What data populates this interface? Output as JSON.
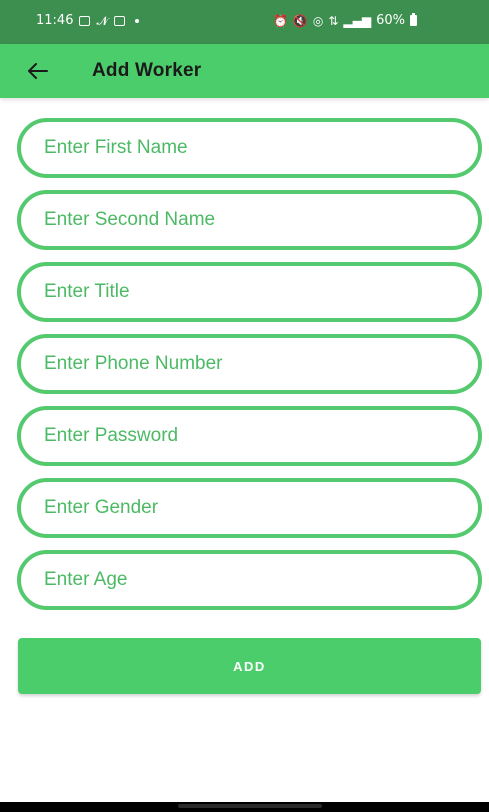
{
  "status_bar": {
    "time": "11:46",
    "network": "⇅",
    "battery_level": "60%"
  },
  "app_bar": {
    "title": "Add Worker",
    "back_icon": "arrow-left-icon"
  },
  "form": {
    "fields": [
      {
        "placeholder": "Enter First Name",
        "value": ""
      },
      {
        "placeholder": "Enter Second Name",
        "value": ""
      },
      {
        "placeholder": "Enter Title",
        "value": ""
      },
      {
        "placeholder": "Enter Phone Number",
        "value": ""
      },
      {
        "placeholder": "Enter Password",
        "value": ""
      },
      {
        "placeholder": "Enter Gender",
        "value": ""
      },
      {
        "placeholder": "Enter Age",
        "value": ""
      }
    ],
    "submit_label": "ADD"
  },
  "colors": {
    "status_bar": "#3d8f4f",
    "accent": "#4ccd6b",
    "field_border": "#55c96e",
    "placeholder": "#4cba65"
  }
}
